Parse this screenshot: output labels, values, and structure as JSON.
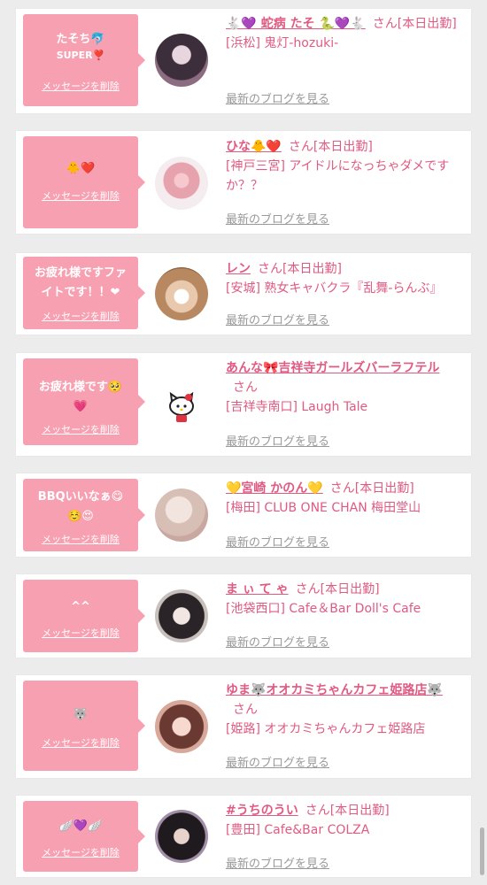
{
  "cards": [
    {
      "bubble_line1": "たそち🐬",
      "bubble_line2": "SUPER❣️",
      "delete_label": "メッセージを削除",
      "name": "🐇💜 蛇病 たそ 🐍💜🐇",
      "san": "さん",
      "status": "[本日出勤]",
      "shop": "[浜松] 鬼灯-hozuki-",
      "blog_label": "最新のブログを見る"
    },
    {
      "bubble_line1": "🐥❤️",
      "bubble_line2": "",
      "delete_label": "メッセージを削除",
      "name": "ひな🐥❤️",
      "san": "さん",
      "status": "[本日出勤]",
      "shop": "[神戸三宮] アイドルになっちゃダメですか？？",
      "blog_label": "最新のブログを見る"
    },
    {
      "bubble_line1": "お疲れ様ですファ",
      "bubble_line2": "イトです！！❤",
      "delete_label": "メッセージを削除",
      "name": "レン",
      "san": "さん",
      "status": "[本日出勤]",
      "shop": "[安城] 熟女キャバクラ『乱舞-らんぶ』",
      "blog_label": "最新のブログを見る"
    },
    {
      "bubble_line1": "お疲れ様です🥺",
      "bubble_line2": "💗",
      "delete_label": "メッセージを削除",
      "name": "あんな🎀吉祥寺ガールズバーラフテル",
      "san": "さん",
      "status": "",
      "shop": "[吉祥寺南口] Laugh Tale",
      "blog_label": "最新のブログを見る"
    },
    {
      "bubble_line1": "BBQいいなぁ😋",
      "bubble_line2": "☺️😍",
      "delete_label": "メッセージを削除",
      "name": "💛宮崎 かのん💛",
      "san": "さん",
      "status": "[本日出勤]",
      "shop": "[梅田] CLUB ONE CHAN 梅田堂山",
      "blog_label": "最新のブログを見る"
    },
    {
      "bubble_line1": "^^",
      "bubble_line2": "",
      "delete_label": "メッセージを削除",
      "name": "ま ぃ て ゃ",
      "san": "さん",
      "status": "[本日出勤]",
      "shop": "[池袋西口] Cafe＆Bar Doll's Cafe",
      "blog_label": "最新のブログを見る"
    },
    {
      "bubble_line1": "🐺",
      "bubble_line2": "",
      "delete_label": "メッセージを削除",
      "name": "ゆま🐺オオカミちゃんカフェ姫路店🐺",
      "san": "さん",
      "status": "",
      "shop": "[姫路] オオカミちゃんカフェ姫路店",
      "blog_label": "最新のブログを見る"
    },
    {
      "bubble_line1": "🪽💜🪽",
      "bubble_line2": "",
      "delete_label": "メッセージを削除",
      "name": "#うちのうい",
      "san": "さん",
      "status": "[本日出勤]",
      "shop": "[豊田] Cafe&Bar COLZA",
      "blog_label": "最新のブログを見る"
    }
  ],
  "colors": {
    "accent": "#e05a82",
    "bubble": "#f7a0b1",
    "link_gray": "#999999",
    "background": "#ececec"
  }
}
